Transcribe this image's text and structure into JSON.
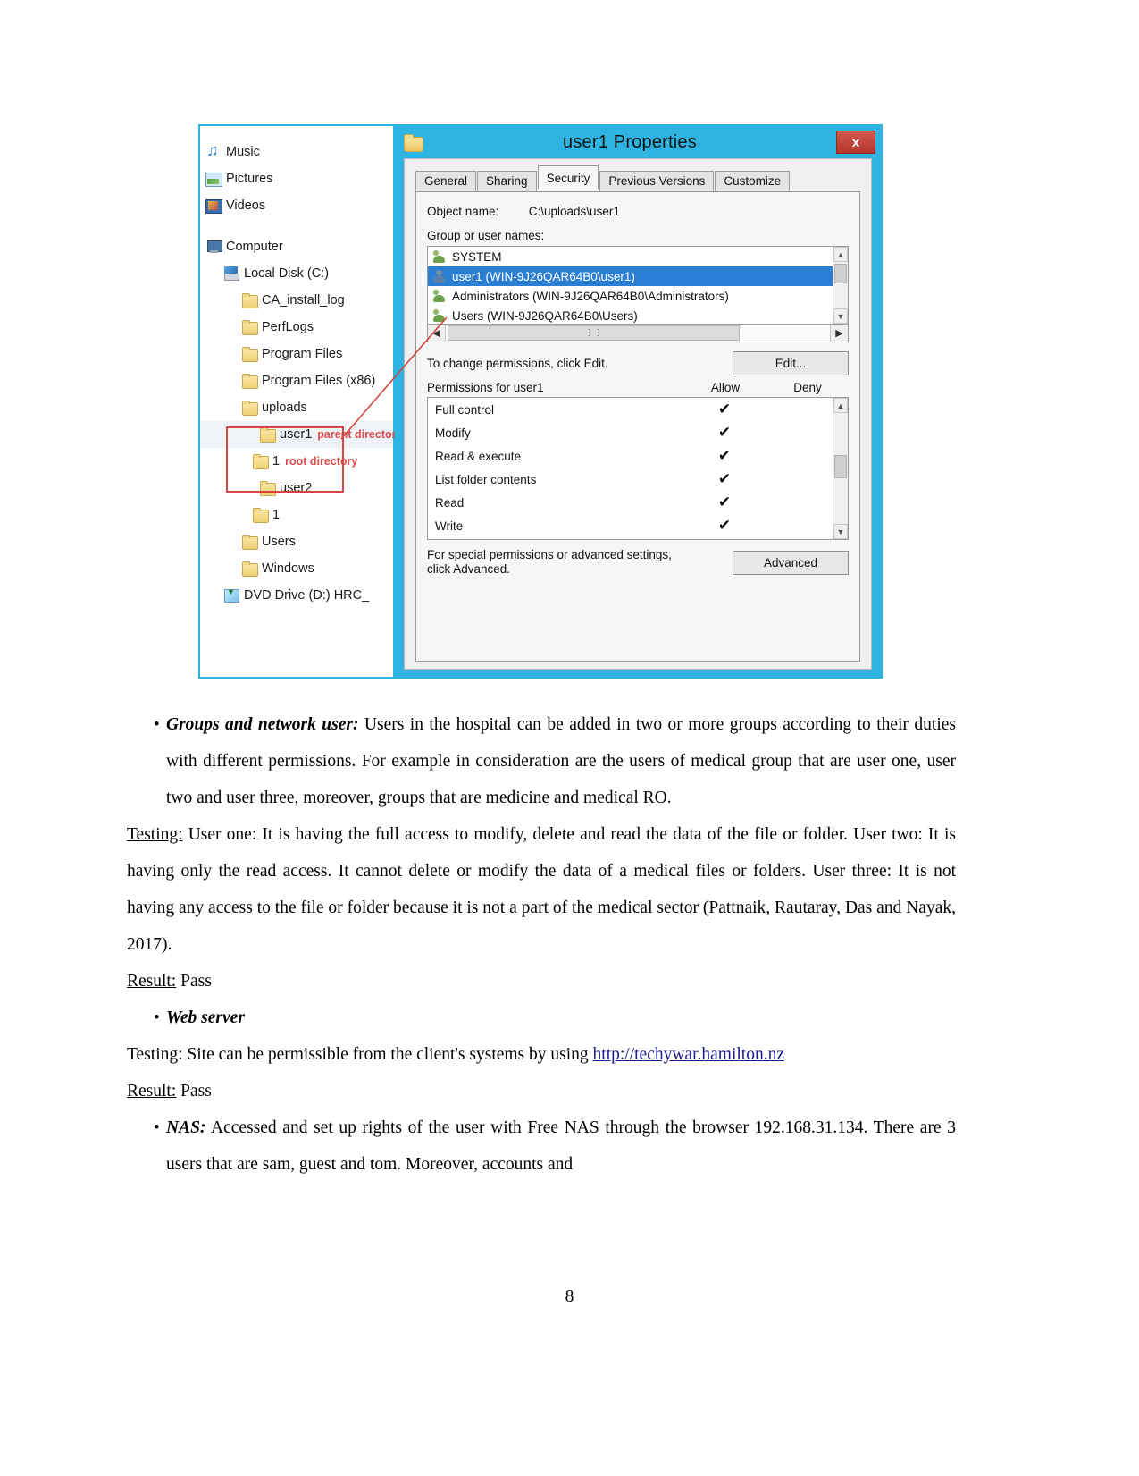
{
  "figure": {
    "explorer": {
      "items": [
        {
          "label": "Music",
          "icon": "music-icon",
          "indent": 1
        },
        {
          "label": "Pictures",
          "icon": "picture-icon",
          "indent": 1
        },
        {
          "label": "Videos",
          "icon": "video-icon",
          "indent": 1
        },
        {
          "label": "Computer",
          "icon": "computer-icon",
          "indent": 1
        },
        {
          "label": "Local Disk (C:)",
          "icon": "disk-icon",
          "indent": 2
        },
        {
          "label": "CA_install_log",
          "icon": "folder-icon",
          "indent": 3
        },
        {
          "label": "PerfLogs",
          "icon": "folder-icon",
          "indent": 3
        },
        {
          "label": "Program Files",
          "icon": "folder-icon",
          "indent": 3
        },
        {
          "label": "Program Files (x86)",
          "icon": "folder-icon",
          "indent": 3
        },
        {
          "label": "uploads",
          "icon": "folder-icon",
          "indent": 3
        },
        {
          "label": "user1",
          "icon": "folder-icon",
          "indent": 4,
          "annotation": "parent directory"
        },
        {
          "label": "1",
          "icon": "folder-icon",
          "indent": 5,
          "annotation": "root directory"
        },
        {
          "label": "user2",
          "icon": "folder-icon",
          "indent": 4
        },
        {
          "label": "1",
          "icon": "folder-icon",
          "indent": 5
        },
        {
          "label": "Users",
          "icon": "folder-icon",
          "indent": 3
        },
        {
          "label": "Windows",
          "icon": "folder-icon",
          "indent": 3
        },
        {
          "label": "DVD Drive (D:) HRC_",
          "icon": "dvd-icon",
          "indent": 2
        }
      ]
    },
    "dialog": {
      "title": "user1 Properties",
      "close_label": "x",
      "tabs": [
        {
          "label": "General",
          "active": false
        },
        {
          "label": "Sharing",
          "active": false
        },
        {
          "label": "Security",
          "active": true
        },
        {
          "label": "Previous Versions",
          "active": false
        },
        {
          "label": "Customize",
          "active": false
        }
      ],
      "object_name_label": "Object name:",
      "object_name_value": "C:\\uploads\\user1",
      "group_list_label": "Group or user names:",
      "group_list": [
        {
          "name": "SYSTEM",
          "type": "group",
          "selected": false
        },
        {
          "name": "user1 (WIN-9J26QAR64B0\\user1)",
          "type": "user",
          "selected": true
        },
        {
          "name": "Administrators (WIN-9J26QAR64B0\\Administrators)",
          "type": "group",
          "selected": false
        },
        {
          "name": "Users (WIN-9J26QAR64B0\\Users)",
          "type": "group",
          "selected": false
        }
      ],
      "edit_hint": "To change permissions, click Edit.",
      "edit_button": "Edit...",
      "permissions_label": "Permissions for user1",
      "allow_header": "Allow",
      "deny_header": "Deny",
      "permissions": [
        {
          "name": "Full control",
          "allow": "✔",
          "deny": "",
          "highlighted": true
        },
        {
          "name": "Modify",
          "allow": "✔",
          "deny": ""
        },
        {
          "name": "Read & execute",
          "allow": "✔",
          "deny": ""
        },
        {
          "name": "List folder contents",
          "allow": "✔",
          "deny": ""
        },
        {
          "name": "Read",
          "allow": "✔",
          "deny": ""
        },
        {
          "name": "Write",
          "allow": "✔",
          "deny": ""
        }
      ],
      "advanced_hint_line1": "For special permissions or advanced settings,",
      "advanced_hint_line2": "click Advanced.",
      "advanced_button": "Advanced"
    },
    "colors": {
      "window_accent": "#2fb3e0",
      "selection": "#2a7fd4",
      "annotation_red": "#d4463f",
      "annotation_text_red": "#e04a4a"
    }
  },
  "document": {
    "bullets": [
      {
        "marker": "•",
        "bold_italic_lead": "Groups and network user:",
        "body": " Users in the hospital can be added in two or more groups according to their duties with different permissions. For example in consideration are the users of medical group that are user one, user two and user three, moreover, groups that are medicine and medical RO."
      },
      {
        "marker": "•",
        "bold_italic_lead": "Web server",
        "body": ""
      },
      {
        "marker": "•",
        "bold_italic_lead": "NAS:",
        "body": " Accessed and set up rights of the user with Free NAS through the browser 192.168.31.134. There are 3 users that are sam, guest and tom. Moreover, accounts and"
      }
    ],
    "testing_1": {
      "label": "Testing:",
      "underlined": true,
      "body": " User one: It is having the full access to modify, delete and read the data of the file or folder. User two: It is having only the read access. It cannot delete or modify the data of a medical files or folders. User three: It is not having any access to the file or folder because it is not a part of the medical sector (Pattnaik, Rautaray, Das and Nayak, 2017)."
    },
    "result_1": {
      "label": "Result:",
      "value": " Pass"
    },
    "testing_2": {
      "label": "Testing:",
      "underlined": false,
      "body": " Site can be permissible from the client's systems by using ",
      "link_text": "http://techywar.hamilton.nz"
    },
    "result_2": {
      "label": "Result:",
      "value": " Pass"
    },
    "page_number": "8"
  }
}
